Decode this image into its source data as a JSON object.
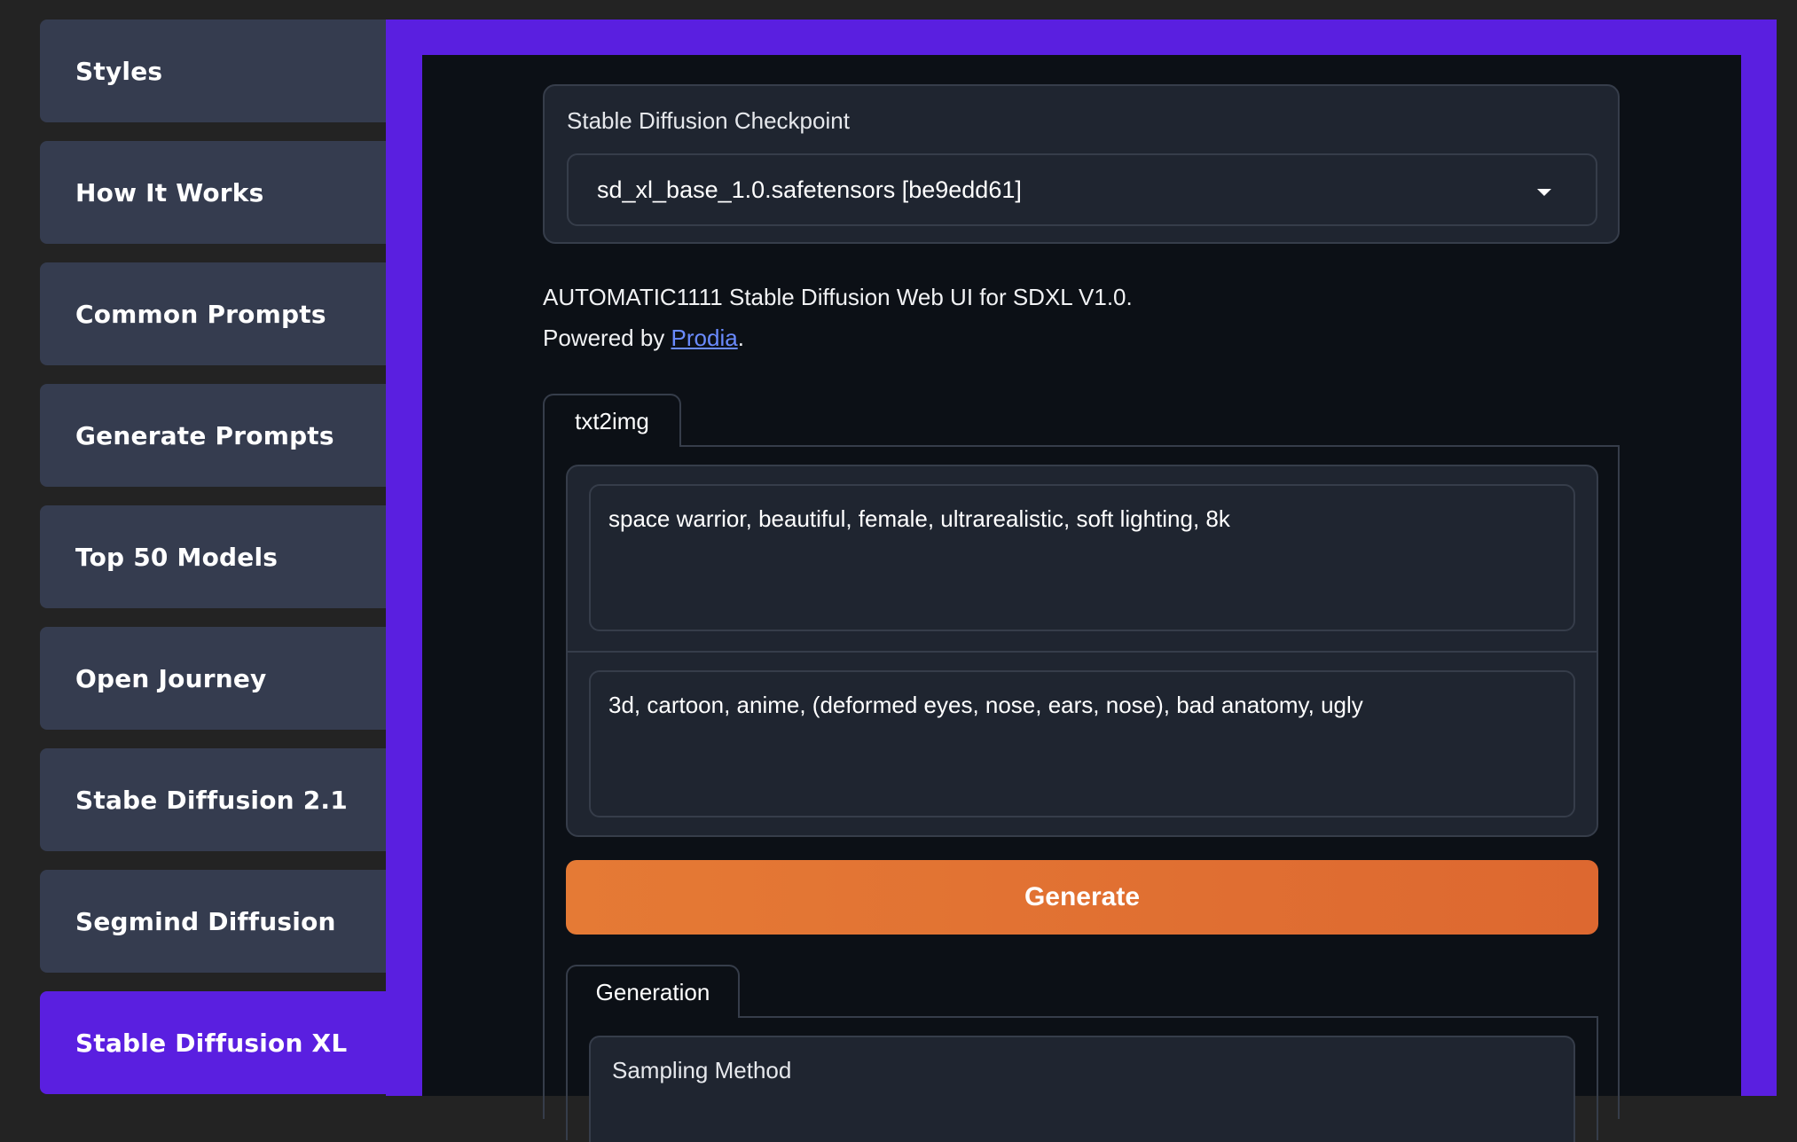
{
  "sidebar": {
    "items": [
      {
        "label": "Styles"
      },
      {
        "label": "How It Works"
      },
      {
        "label": "Common Prompts"
      },
      {
        "label": "Generate Prompts"
      },
      {
        "label": "Top 50 Models"
      },
      {
        "label": "Open Journey"
      },
      {
        "label": "Stabe Diffusion 2.1"
      },
      {
        "label": "Segmind Diffusion"
      },
      {
        "label": "Stable Diffusion XL"
      }
    ],
    "active_item": "Stable Diffusion XL"
  },
  "checkpoint": {
    "label": "Stable Diffusion Checkpoint",
    "selected_value": "sd_xl_base_1.0.safetensors [be9edd61]"
  },
  "description": {
    "line1": "AUTOMATIC1111 Stable Diffusion Web UI for SDXL V1.0.",
    "powered_prefix": "Powered by ",
    "powered_link": "Prodia",
    "powered_suffix": "."
  },
  "tabs": {
    "main_tab": "txt2img"
  },
  "prompts": {
    "positive": "space warrior, beautiful, female, ultrarealistic, soft lighting, 8k",
    "negative": "3d, cartoon, anime, (deformed eyes, nose, ears, nose), bad anatomy, ugly"
  },
  "generate_button": "Generate",
  "settings": {
    "tab": "Generation",
    "sampling_label": "Sampling Method"
  },
  "colors": {
    "accent": "#5a1fe0",
    "sidebar_item": "#353c4f",
    "generate_button": "#e57a35",
    "link": "#6a8bff"
  }
}
